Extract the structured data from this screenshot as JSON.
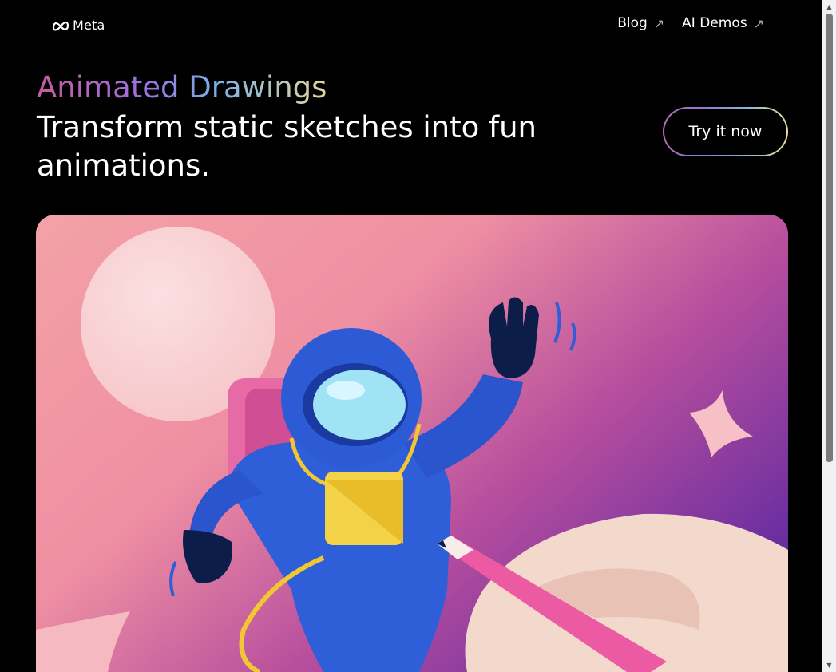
{
  "header": {
    "logo_text": "Meta",
    "nav": [
      {
        "label": "Blog",
        "icon": "arrow-up-right-icon"
      },
      {
        "label": "AI Demos",
        "icon": "arrow-up-right-icon"
      }
    ]
  },
  "hero": {
    "eyebrow": "Animated Drawings",
    "headline": "Transform static sketches into fun animations.",
    "cta_label": "Try it now",
    "illustration": "astronaut-drawing-illustration"
  },
  "colors": {
    "background": "#000000",
    "hero_pink": "#f0a0a4",
    "hero_purple": "#8e3ca0",
    "astronaut_blue": "#2f5fd8"
  }
}
